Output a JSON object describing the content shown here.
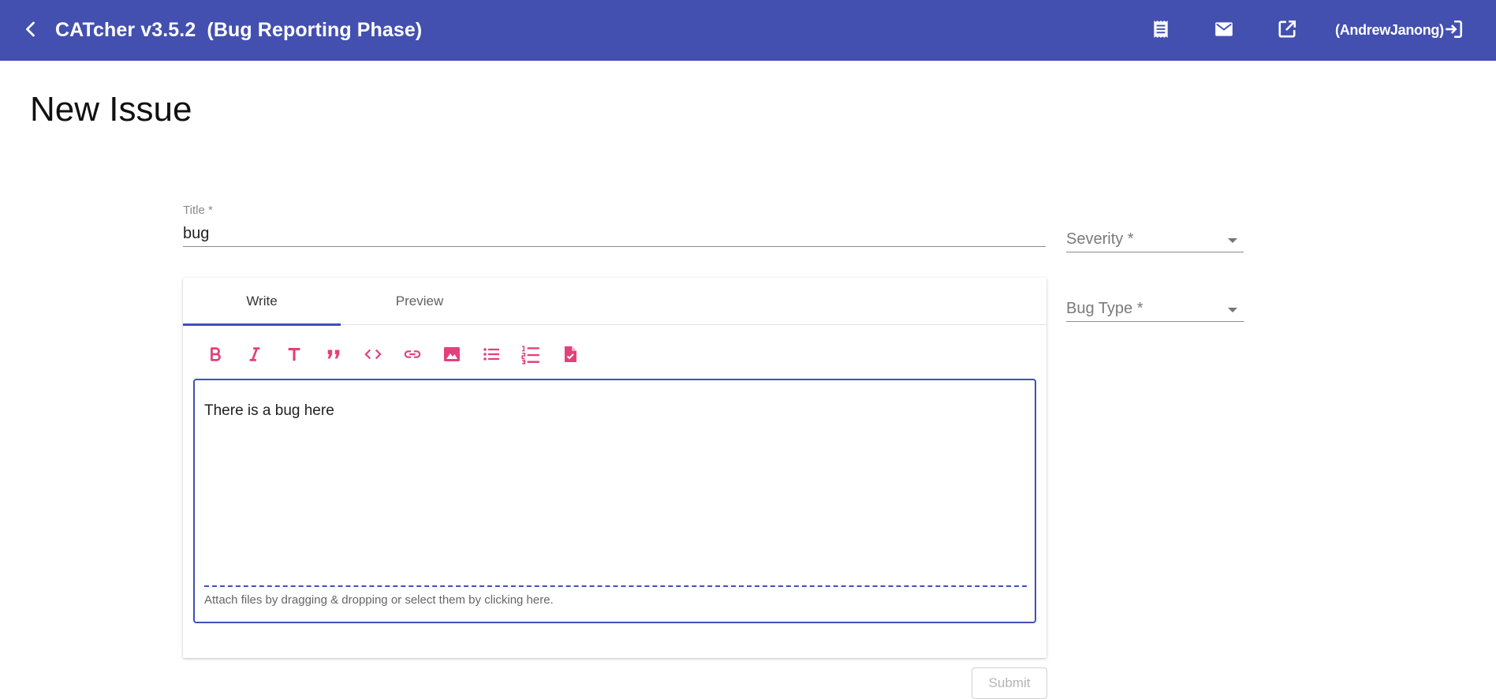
{
  "header": {
    "app_title": "CATcher v3.5.2  (Bug Reporting Phase)",
    "user": "(AndrewJanong)",
    "bg_color": "#4350af",
    "icons": [
      "back-arrow-icon",
      "receipt-icon",
      "mail-icon",
      "open-in-new-icon",
      "logout-icon"
    ]
  },
  "page": {
    "title": "New Issue"
  },
  "form": {
    "title_label": "Title *",
    "title_value": "bug",
    "severity_placeholder": "Severity *",
    "bug_type_placeholder": "Bug Type *"
  },
  "editor": {
    "tabs": [
      {
        "label": "Write",
        "active": true
      },
      {
        "label": "Preview",
        "active": false
      }
    ],
    "toolbar_icons": [
      "bold-icon",
      "italic-icon",
      "heading-icon",
      "quote-icon",
      "code-icon",
      "link-icon",
      "image-icon",
      "bulleted-list-icon",
      "numbered-list-icon",
      "task-file-icon"
    ],
    "accent_color": "#e4407a",
    "body_text": "There is a bug here",
    "attach_hint": "Attach files by dragging & dropping or select them by clicking here."
  },
  "actions": {
    "submit_label": "Submit"
  }
}
